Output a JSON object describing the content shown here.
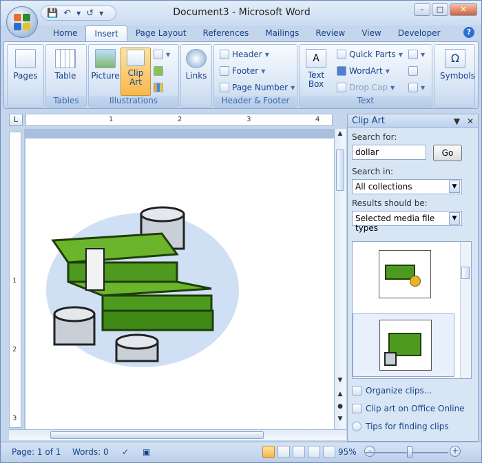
{
  "window": {
    "title": "Document3 - Microsoft Word"
  },
  "tabs": [
    "Home",
    "Insert",
    "Page Layout",
    "References",
    "Mailings",
    "Review",
    "View",
    "Developer"
  ],
  "active_tab": "Insert",
  "ribbon": {
    "pages": {
      "label": "Pages"
    },
    "tables": {
      "table": "Table",
      "group": "Tables"
    },
    "illustrations": {
      "picture": "Picture",
      "clip_art_1": "Clip",
      "clip_art_2": "Art",
      "group": "Illustrations"
    },
    "links": {
      "label": "Links"
    },
    "header_footer": {
      "header": "Header",
      "footer": "Footer",
      "page_number": "Page Number",
      "group": "Header & Footer"
    },
    "text": {
      "text_box_1": "Text",
      "text_box_2": "Box",
      "quick_parts": "Quick Parts",
      "wordart": "WordArt",
      "drop_cap": "Drop Cap",
      "group": "Text"
    },
    "symbols": {
      "label": "Symbols"
    }
  },
  "ruler": {
    "h_numbers": [
      "1",
      "2",
      "3",
      "4"
    ],
    "v_numbers": [
      "1",
      "2",
      "3"
    ]
  },
  "clip_art_pane": {
    "title": "Clip Art",
    "search_for_label": "Search for:",
    "search_value": "dollar",
    "go": "Go",
    "search_in_label": "Search in:",
    "search_in_value": "All collections",
    "results_label": "Results should be:",
    "results_value": "Selected media file types",
    "links": [
      "Organize clips...",
      "Clip art on Office Online",
      "Tips for finding clips"
    ]
  },
  "status": {
    "page": "Page: 1 of 1",
    "words": "Words: 0",
    "zoom": "95%"
  },
  "colors": {
    "money_green": "#4e9a1e",
    "money_dark": "#2f6b0f",
    "coin": "#c9cfd6",
    "halo": "#9ec0e6"
  }
}
